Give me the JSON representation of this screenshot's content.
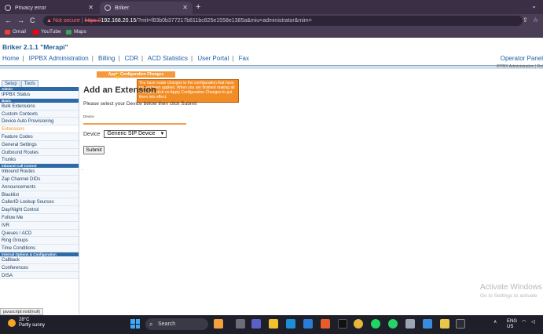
{
  "browser": {
    "tabs": [
      {
        "title": "Privacy error"
      },
      {
        "title": "Briker"
      }
    ],
    "address": {
      "warning": "Not secure",
      "url_scheme": "https://",
      "url_host": "192.168.20.15",
      "url_rest": "/?mit=f83b0b377217b811bc825e1558e1385a&miu=administrator&mim="
    },
    "bookmarks": [
      {
        "label": "Gmail"
      },
      {
        "label": "YouTube"
      },
      {
        "label": "Maps"
      }
    ]
  },
  "header": {
    "brand": "Briker 2.1.1 \"Merapi\"",
    "nav": [
      "Home",
      "IPPBX Administration",
      "Billing",
      "CDR",
      "ACD Statistics",
      "User Portal",
      "Fax"
    ],
    "operator_panel": "Operator Panel",
    "admin_band": "IPPBX Administration | Rei"
  },
  "apply": {
    "label": "Apply Configuration Changes",
    "tooltip": "You have made changes to the configuration that have not yet been applied. When you are finished making all changes, click on Apply Configuration Changes to put them into effect."
  },
  "sidebar": {
    "tabs": [
      "Setup",
      "Tools"
    ],
    "groups": [
      {
        "section": "Admin",
        "items": [
          "IPPBX Status"
        ]
      },
      {
        "section": "Basic",
        "items": [
          "Bulk Extensions",
          "Custom Contexts",
          "Device Auto Provisioning",
          "Extensions",
          "Feature Codes",
          "General Settings",
          "Outbound Routes",
          "Trunks"
        ]
      },
      {
        "section": "Inbound Call Control",
        "items": [
          "Inbound Routes",
          "Zap Channel DIDs",
          "Announcements",
          "Blacklist",
          "CallerID Lookup Sources",
          "Day/Night Control",
          "Follow Me",
          "IVR",
          "Queues / ACD",
          "Ring Groups",
          "Time Conditions"
        ]
      },
      {
        "section": "Internal Options & Configuration",
        "items": [
          "Callback",
          "Conferences",
          "DISA"
        ]
      }
    ],
    "active_item": "Extensions"
  },
  "main": {
    "title": "Add an Extension",
    "instruction": "Please select your Device below then click Submit",
    "device_small_label": "Device",
    "device_label": "Device",
    "device_value": "Generic SIP Device",
    "submit_label": "Submit",
    "dot": "."
  },
  "status_link": "javascript:void(null)",
  "watermark": {
    "line1": "Activate Windows",
    "line2": "Go to Settings to activate"
  },
  "taskbar": {
    "temperature": "28°C",
    "weather": "Partly sunny",
    "search_label": "Search",
    "lang_line1": "ENG",
    "lang_line2": "US"
  }
}
